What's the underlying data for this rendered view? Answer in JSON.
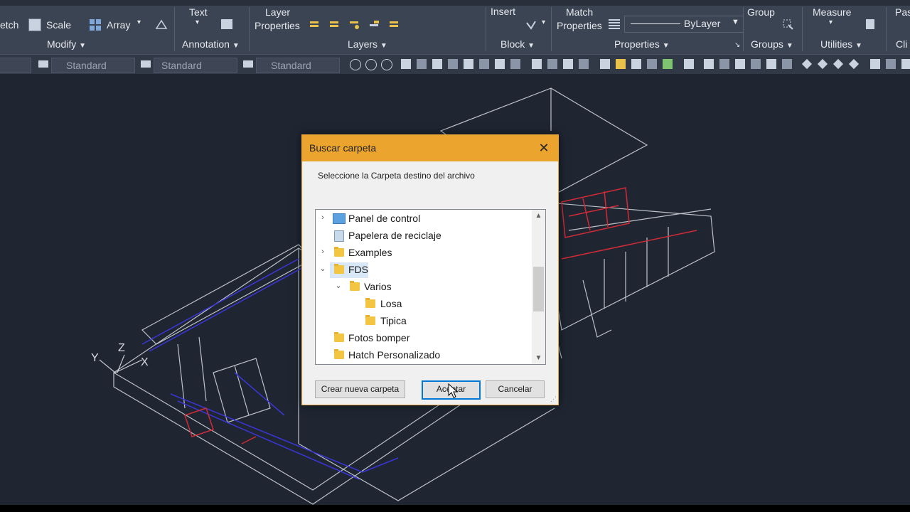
{
  "ribbon": {
    "partial_left_top": "etch",
    "scale": "Scale",
    "array": "Array",
    "text": "Text",
    "layer_properties_1": "Layer",
    "layer_properties_2": "Properties",
    "insert": "Insert",
    "match_properties_1": "Match",
    "match_properties_2": "Properties",
    "bylayer": "ByLayer",
    "group": "Group",
    "measure": "Measure",
    "partial_right": "Pas",
    "panels": {
      "modify": "Modify",
      "annotation": "Annotation",
      "layers": "Layers",
      "block": "Block",
      "properties": "Properties",
      "groups": "Groups",
      "utilities": "Utilities",
      "clip": "Cli"
    }
  },
  "toolbar": {
    "style1": "Standard",
    "style2": "Standard",
    "style3": "Standard"
  },
  "dialog": {
    "title": "Buscar carpeta",
    "message": "Seleccione la Carpeta destino del archivo",
    "tree": [
      {
        "label": "Panel de control",
        "chevron": "›",
        "icon": "control-panel-icon",
        "level": 0
      },
      {
        "label": "Papelera de reciclaje",
        "chevron": "",
        "icon": "recycle-bin-icon",
        "level": 0
      },
      {
        "label": "Examples",
        "chevron": "›",
        "icon": "folder-icon",
        "level": 0
      },
      {
        "label": "FDS",
        "chevron": "⌄",
        "icon": "folder-icon",
        "level": 0,
        "selected": true
      },
      {
        "label": "Varios",
        "chevron": "⌄",
        "icon": "folder-icon",
        "level": 1
      },
      {
        "label": "Losa",
        "chevron": "",
        "icon": "folder-icon",
        "level": 2
      },
      {
        "label": "Tipica",
        "chevron": "",
        "icon": "folder-icon",
        "level": 2
      },
      {
        "label": "Fotos bomper",
        "chevron": "",
        "icon": "folder-icon",
        "level": 0
      },
      {
        "label": "Hatch Personalizado",
        "chevron": "",
        "icon": "folder-icon",
        "level": 0
      }
    ],
    "buttons": {
      "new_folder": "Crear nueva carpeta",
      "accept": "Aceptar",
      "cancel": "Cancelar"
    }
  },
  "axis": {
    "x": "X",
    "y": "Y",
    "z": "Z"
  }
}
